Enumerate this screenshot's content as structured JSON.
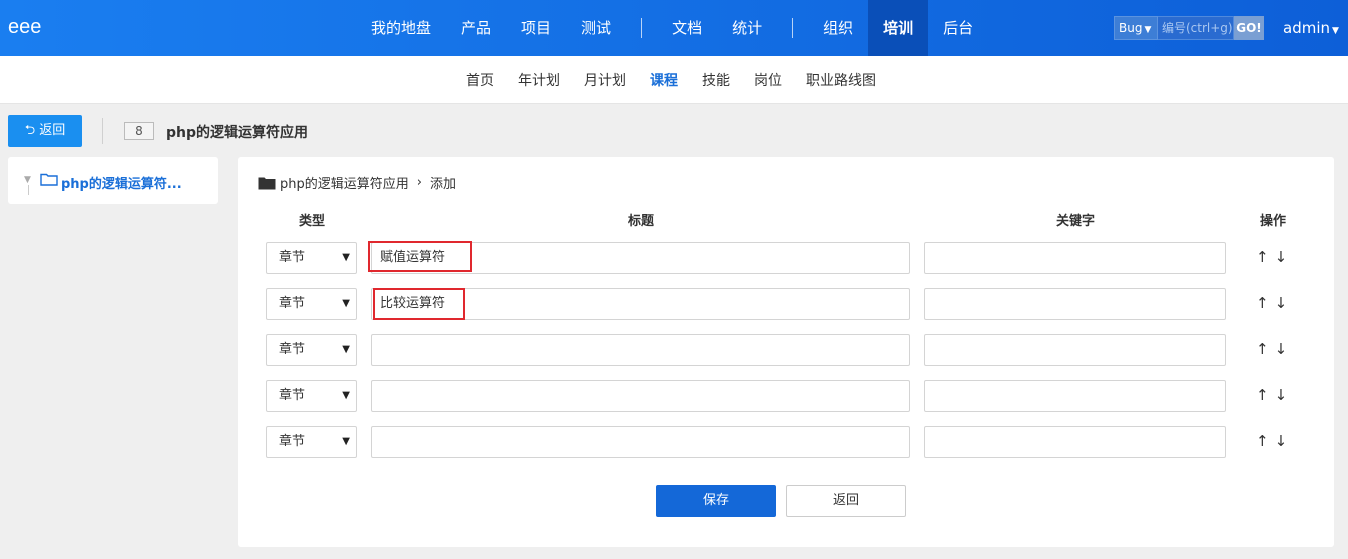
{
  "topnav": {
    "brand": "eee",
    "items": [
      {
        "label": "我的地盘"
      },
      {
        "label": "产品"
      },
      {
        "label": "项目"
      },
      {
        "label": "测试"
      },
      {
        "label": "文档"
      },
      {
        "label": "统计"
      },
      {
        "label": "组织"
      },
      {
        "label": "培训",
        "active": true
      },
      {
        "label": "后台"
      }
    ],
    "search": {
      "type": "Bug",
      "placeholder": "编号(ctrl+g)",
      "go": "GO!"
    },
    "user": "admin"
  },
  "subnav": {
    "items": [
      {
        "label": "首页"
      },
      {
        "label": "年计划"
      },
      {
        "label": "月计划"
      },
      {
        "label": "课程",
        "active": true
      },
      {
        "label": "技能"
      },
      {
        "label": "岗位"
      },
      {
        "label": "职业路线图"
      }
    ]
  },
  "toolbar": {
    "back_label": "返回",
    "id": "8",
    "title": "php的逻辑运算符应用"
  },
  "tree": {
    "root_label": "php的逻辑运算符..."
  },
  "breadcrumb": {
    "course": "php的逻辑运算符应用",
    "current": "添加"
  },
  "table": {
    "headers": {
      "type": "类型",
      "title": "标题",
      "keywords": "关键字",
      "actions": "操作"
    },
    "rows": [
      {
        "type": "章节",
        "title": "赋值运算符",
        "keywords": "",
        "highlighted": true
      },
      {
        "type": "章节",
        "title": "比较运算符",
        "keywords": "",
        "highlighted": true
      },
      {
        "type": "章节",
        "title": "",
        "keywords": "",
        "highlighted": false
      },
      {
        "type": "章节",
        "title": "",
        "keywords": "",
        "highlighted": false
      },
      {
        "type": "章节",
        "title": "",
        "keywords": "",
        "highlighted": false
      }
    ],
    "up_icon": "arrow-up-icon",
    "down_icon": "arrow-down-icon"
  },
  "form": {
    "save_label": "保存",
    "back_label": "返回"
  },
  "colors": {
    "nav_bg": "#1a7ef0",
    "nav_active": "#0a4fb8",
    "accent": "#1a6fd8",
    "save": "#1468d8",
    "highlight_box": "#e0282e"
  }
}
